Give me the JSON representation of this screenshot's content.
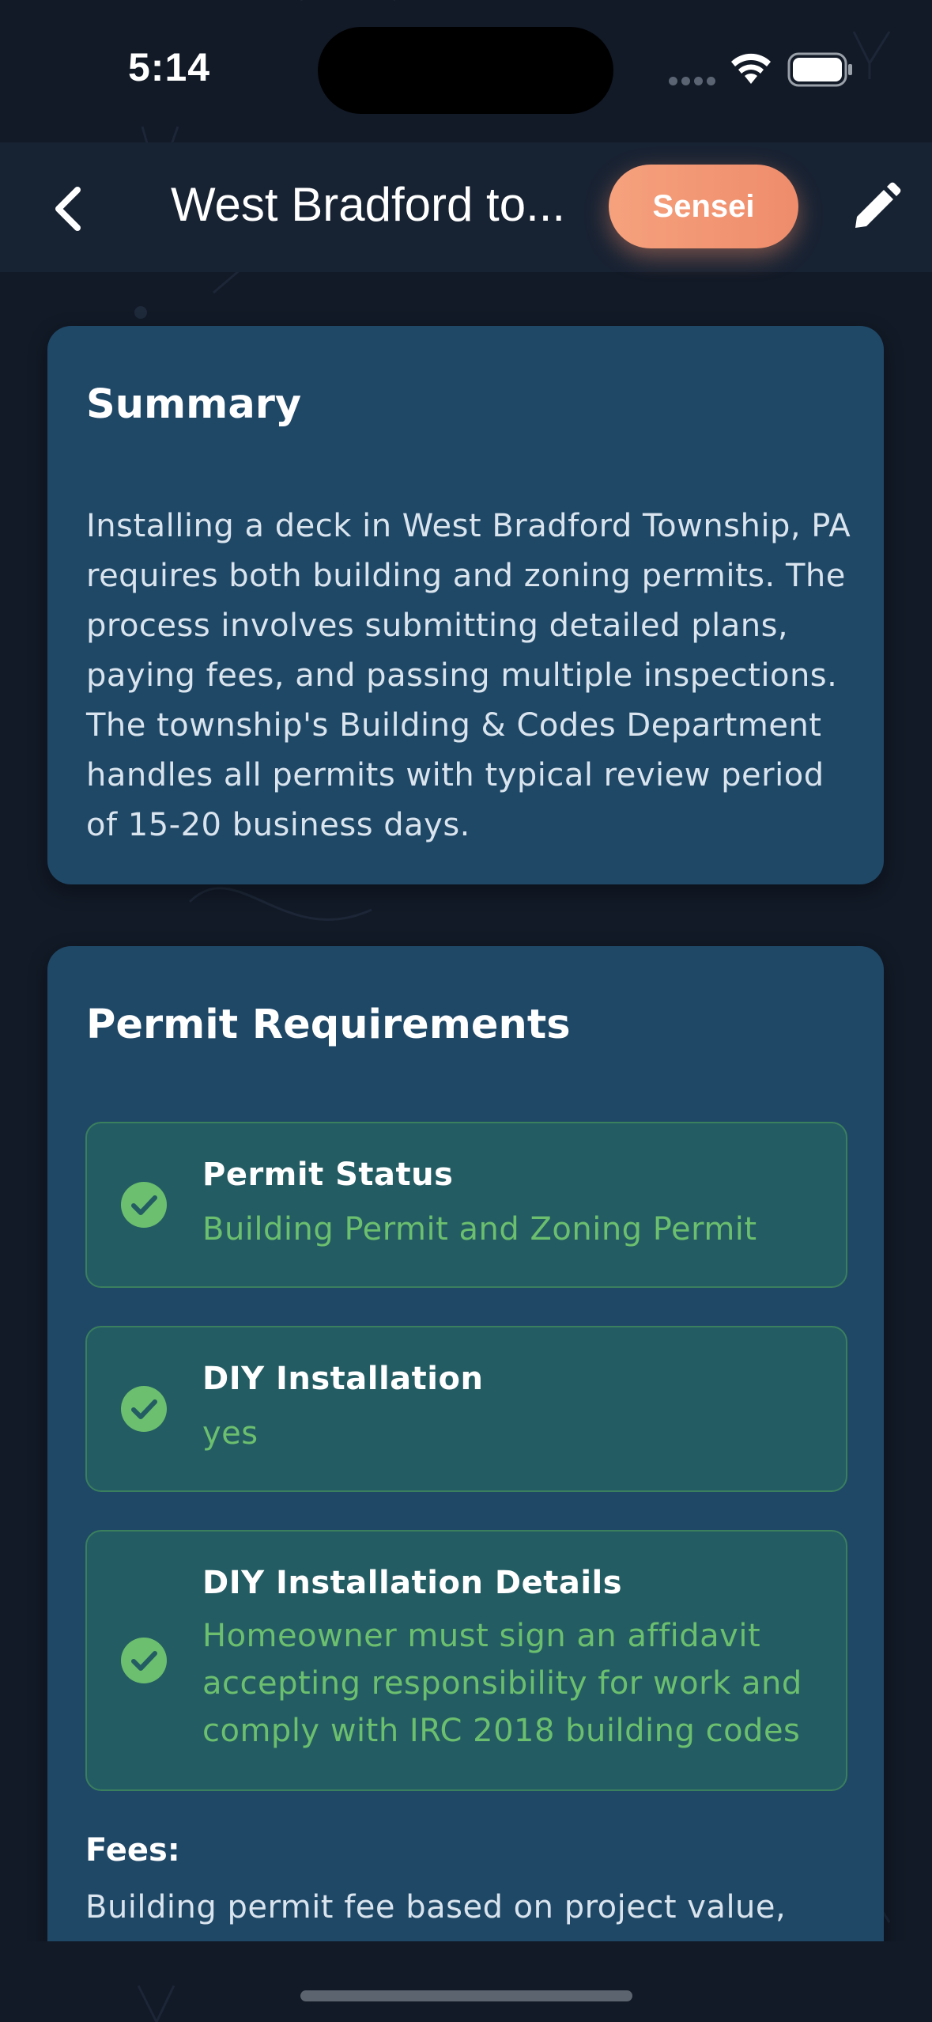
{
  "status_bar": {
    "time": "5:14"
  },
  "nav": {
    "title": "West Bradford to...",
    "sensei_label": "Sensei"
  },
  "summary": {
    "heading": "Summary",
    "text": "Installing a deck in West Bradford Township, PA requires both building and zoning permits. The process involves submitting detailed plans, paying fees, and passing multiple inspections. The township's Building & Codes Department handles all permits with typical review period of 15-20 business days."
  },
  "permit": {
    "heading": "Permit Requirements",
    "items": [
      {
        "title": "Permit Status",
        "value": "Building Permit and Zoning Permit"
      },
      {
        "title": "DIY Installation",
        "value": "yes"
      },
      {
        "title": "DIY Installation Details",
        "value": "Homeowner must sign an affidavit accepting responsibility for work and comply with IRC 2018 building codes"
      }
    ],
    "fees_label": "Fees:",
    "fees_text": "Building permit fee based on project value,"
  },
  "colors": {
    "background": "#121a27",
    "card": "#1f4867",
    "accent": "#ee8c6b",
    "success": "#6bbf6e"
  }
}
